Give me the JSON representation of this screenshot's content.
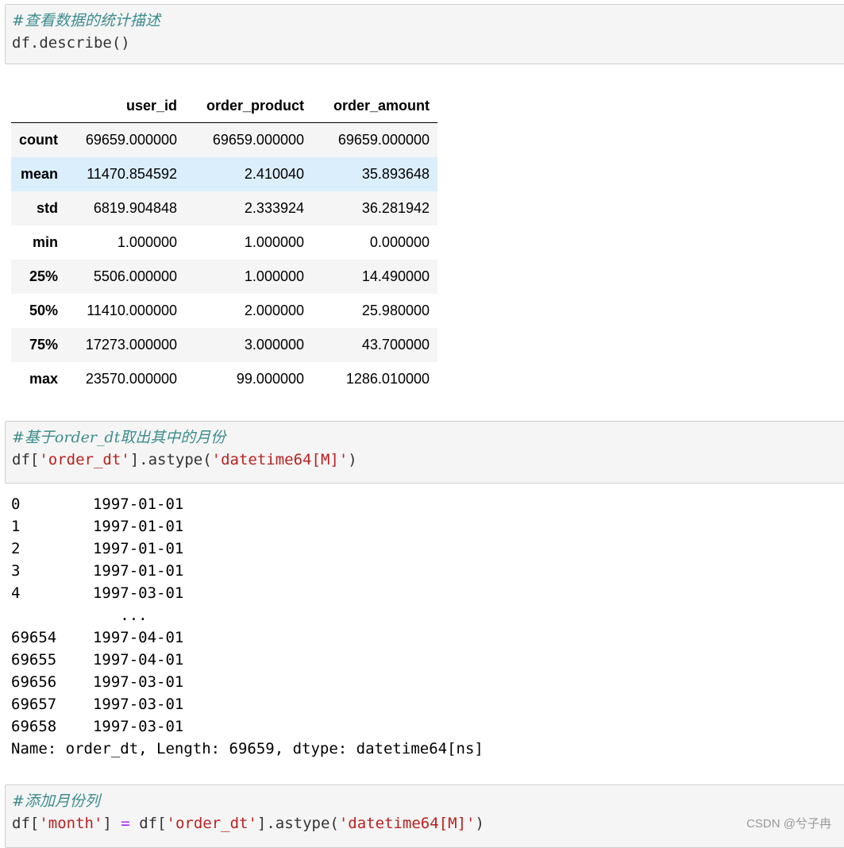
{
  "cells": [
    {
      "comment": "#查看数据的统计描述",
      "code": "df.describe()"
    },
    {
      "comment": "#基于order_dt取出其中的月份",
      "code_parts": [
        "df[",
        "'order_dt'",
        "].astype(",
        "'datetime64[M]'",
        ")"
      ]
    },
    {
      "comment": "#添加月份列",
      "code_parts": [
        "df[",
        "'month'",
        "] ",
        "=",
        " df[",
        "'order_dt'",
        "].astype(",
        "'datetime64[M]'",
        ")"
      ]
    }
  ],
  "describe_table": {
    "columns": [
      "",
      "user_id",
      "order_product",
      "order_amount"
    ],
    "rows": [
      {
        "label": "count",
        "values": [
          "69659.000000",
          "69659.000000",
          "69659.000000"
        ]
      },
      {
        "label": "mean",
        "values": [
          "11470.854592",
          "2.410040",
          "35.893648"
        ]
      },
      {
        "label": "std",
        "values": [
          "6819.904848",
          "2.333924",
          "36.281942"
        ]
      },
      {
        "label": "min",
        "values": [
          "1.000000",
          "1.000000",
          "0.000000"
        ]
      },
      {
        "label": "25%",
        "values": [
          "5506.000000",
          "1.000000",
          "14.490000"
        ]
      },
      {
        "label": "50%",
        "values": [
          "11410.000000",
          "2.000000",
          "25.980000"
        ]
      },
      {
        "label": "75%",
        "values": [
          "17273.000000",
          "3.000000",
          "43.700000"
        ]
      },
      {
        "label": "max",
        "values": [
          "23570.000000",
          "99.000000",
          "1286.010000"
        ]
      }
    ]
  },
  "series_output": {
    "lines": [
      "0        1997-01-01",
      "1        1997-01-01",
      "2        1997-01-01",
      "3        1997-01-01",
      "4        1997-03-01",
      "            ...",
      "69654    1997-04-01",
      "69655    1997-04-01",
      "69656    1997-03-01",
      "69657    1997-03-01",
      "69658    1997-03-01",
      "Name: order_dt, Length: 69659, dtype: datetime64[ns]"
    ]
  },
  "watermark": "CSDN @兮子冉"
}
